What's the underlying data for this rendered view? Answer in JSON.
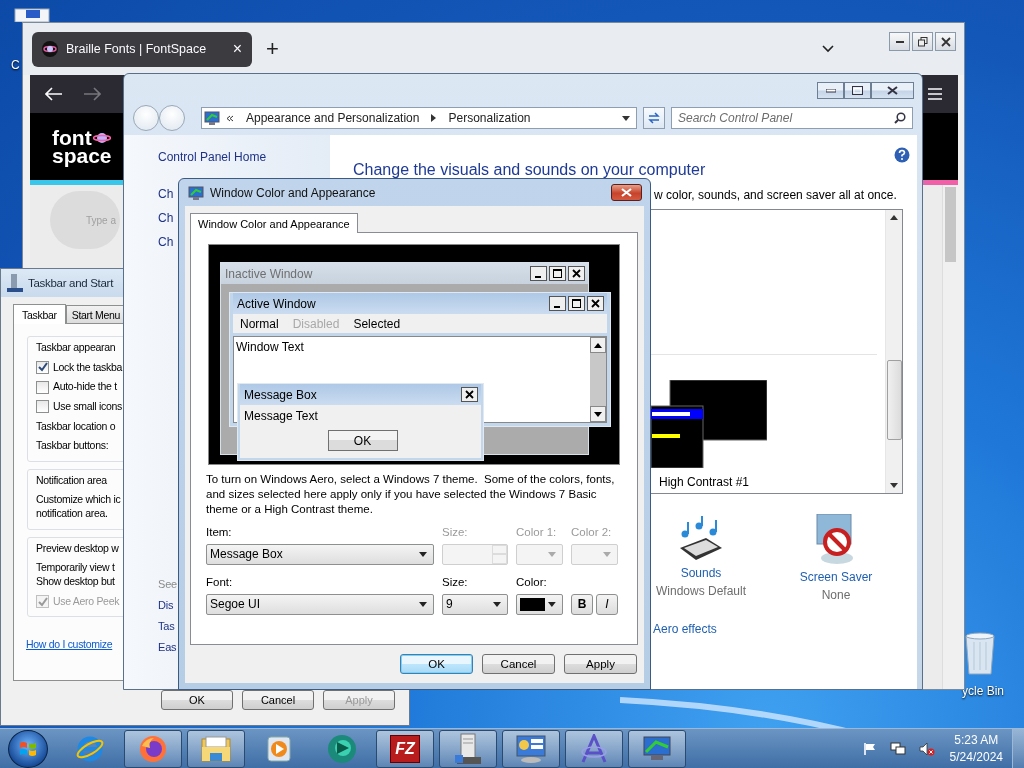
{
  "desktop": {
    "icons": [
      {
        "kind": "file",
        "label": "C"
      },
      {
        "kind": "recycle-bin",
        "label": "ycle Bin"
      }
    ]
  },
  "browser": {
    "tab": {
      "title": "Braille Fonts | FontSpace",
      "close": "×"
    },
    "new_tab": "+",
    "logo": {
      "top": "font",
      "bottom": "space"
    },
    "search": {
      "placeholder": "Type a"
    }
  },
  "taskbar_properties": {
    "title": "Taskbar and Start",
    "tabs": [
      {
        "label": "Taskbar",
        "selected": true
      },
      {
        "label": "Start Menu",
        "selected": false
      }
    ],
    "groups": [
      {
        "title": "Taskbar appearan",
        "rows": [
          {
            "kind": "checkbox",
            "label": "Lock the taskba",
            "checked": true,
            "disabled": false
          },
          {
            "kind": "checkbox",
            "label": "Auto-hide the t",
            "checked": false,
            "disabled": false
          },
          {
            "kind": "checkbox",
            "label": "Use small icons",
            "checked": false,
            "disabled": false
          },
          {
            "kind": "text",
            "label": "Taskbar location o"
          },
          {
            "kind": "text",
            "label": "Taskbar buttons:"
          }
        ]
      },
      {
        "title": "Notification area",
        "rows": [
          {
            "kind": "text",
            "label": "Customize which ic\nnotification area."
          }
        ]
      },
      {
        "title": "Preview desktop w",
        "rows": [
          {
            "kind": "text",
            "label": "Temporarily view t\nShow desktop but"
          },
          {
            "kind": "checkbox",
            "label": "Use Aero Peek",
            "checked": true,
            "disabled": true
          }
        ]
      }
    ],
    "link": "How do I customize",
    "buttons": [
      {
        "label": "OK",
        "disabled": false
      },
      {
        "label": "Cancel",
        "disabled": false
      },
      {
        "label": "Apply",
        "disabled": true
      }
    ]
  },
  "control_panel": {
    "breadcrumb": [
      "Appearance and Personalization",
      "Personalization"
    ],
    "search": {
      "placeholder": "Search Control Panel"
    },
    "sidebar": {
      "items": [
        "Control Panel Home",
        "Ch",
        "Ch",
        "Ch"
      ],
      "see_also": {
        "title": "See",
        "items": [
          "Dis",
          "Tas",
          "Eas"
        ]
      }
    },
    "heading": "Change the visuals and sounds on your computer",
    "subtitle": "w color, sounds, and screen saver all at once.",
    "themes": [
      {
        "name": "High Contrast #1"
      }
    ],
    "settings": [
      {
        "kind": "sounds",
        "label": "Sounds",
        "value": "Windows Default"
      },
      {
        "kind": "screen-saver",
        "label": "Screen Saver",
        "value": "None"
      }
    ],
    "link": "Aero effects"
  },
  "dialog": {
    "title": "Window Color and Appearance",
    "tabs": [
      {
        "label": "Window Color and Appearance",
        "selected": true
      }
    ],
    "preview": {
      "inactive_title": "Inactive Window",
      "active_title": "Active Window",
      "menu": [
        {
          "label": "Normal",
          "disabled": false
        },
        {
          "label": "Disabled",
          "disabled": true
        },
        {
          "label": "Selected",
          "disabled": false
        }
      ],
      "window_text": "Window Text",
      "message_title": "Message Box",
      "message_text": "Message Text",
      "message_button": "OK"
    },
    "description": "To turn on Windows Aero, select a Windows 7 theme.  Some of the colors, fonts, and sizes selected here apply only if you have selected the Windows 7 Basic theme or a High Contrast theme.",
    "fields": [
      {
        "label": "Item:",
        "kind": "dropdown",
        "value": "Message Box",
        "disabled": false
      },
      {
        "label": "Size:",
        "kind": "spinner",
        "disabled": true
      },
      {
        "label": "Color 1:",
        "kind": "color",
        "disabled": true
      },
      {
        "label": "Color 2:",
        "kind": "color",
        "disabled": true
      }
    ],
    "font_fields": [
      {
        "label": "Font:",
        "kind": "dropdown",
        "value": "Segoe UI",
        "disabled": false
      },
      {
        "label": "Size:",
        "kind": "dropdown",
        "value": "9",
        "disabled": false
      },
      {
        "label": "Color:",
        "kind": "color",
        "color": "#000000",
        "disabled": false
      }
    ],
    "style_buttons": [
      {
        "label": "B",
        "kind": "bold"
      },
      {
        "label": "I",
        "kind": "italic"
      }
    ],
    "buttons": [
      {
        "label": "OK",
        "default": true
      },
      {
        "label": "Cancel",
        "default": false
      },
      {
        "label": "Apply",
        "default": false
      }
    ]
  },
  "taskbar": {
    "apps": [
      {
        "kind": "ie",
        "open": false
      },
      {
        "kind": "firefox",
        "open": true
      },
      {
        "kind": "explorer",
        "open": true
      },
      {
        "kind": "media",
        "open": false
      },
      {
        "kind": "circle",
        "open": false
      },
      {
        "kind": "filezilla",
        "label": "FZ",
        "open": true
      },
      {
        "kind": "server",
        "open": true
      },
      {
        "kind": "control-panel",
        "open": true
      },
      {
        "kind": "font",
        "open": true
      },
      {
        "kind": "personalization",
        "open": true
      }
    ],
    "clock": {
      "time": "5:23 AM",
      "date": "5/24/2024"
    }
  }
}
